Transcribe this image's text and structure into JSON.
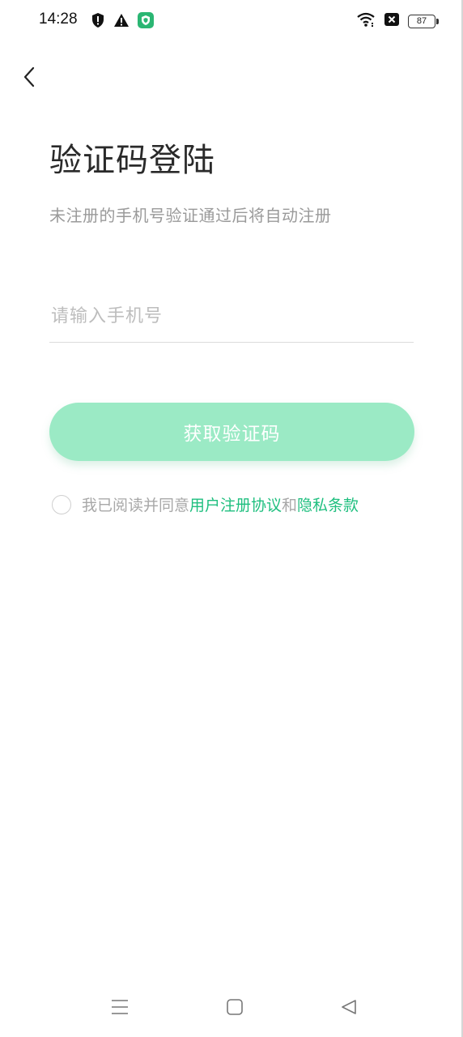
{
  "status_bar": {
    "time": "14:28",
    "battery": "87",
    "left_icons": [
      "shield-icon",
      "warning-icon",
      "security-app-icon"
    ],
    "right_icons": [
      "wifi-icon",
      "sim-off-icon",
      "battery-icon"
    ]
  },
  "header": {
    "back_icon": "chevron-left-icon"
  },
  "main": {
    "title": "验证码登陆",
    "subtitle": "未注册的手机号验证通过后将自动注册",
    "phone_placeholder": "请输入手机号",
    "phone_value": "",
    "submit_label": "获取验证码"
  },
  "agreement": {
    "prefix": "我已阅读并同意",
    "user_agreement": "用户注册协议",
    "connector": "和",
    "privacy_policy": "隐私条款",
    "checked": false
  },
  "nav_bar": {
    "icons": [
      "menu-icon",
      "home-icon",
      "back-triangle-icon"
    ]
  },
  "colors": {
    "accent": "#1fbf7f",
    "button_bg": "#9beac5",
    "muted_text": "#9a9a9a"
  }
}
